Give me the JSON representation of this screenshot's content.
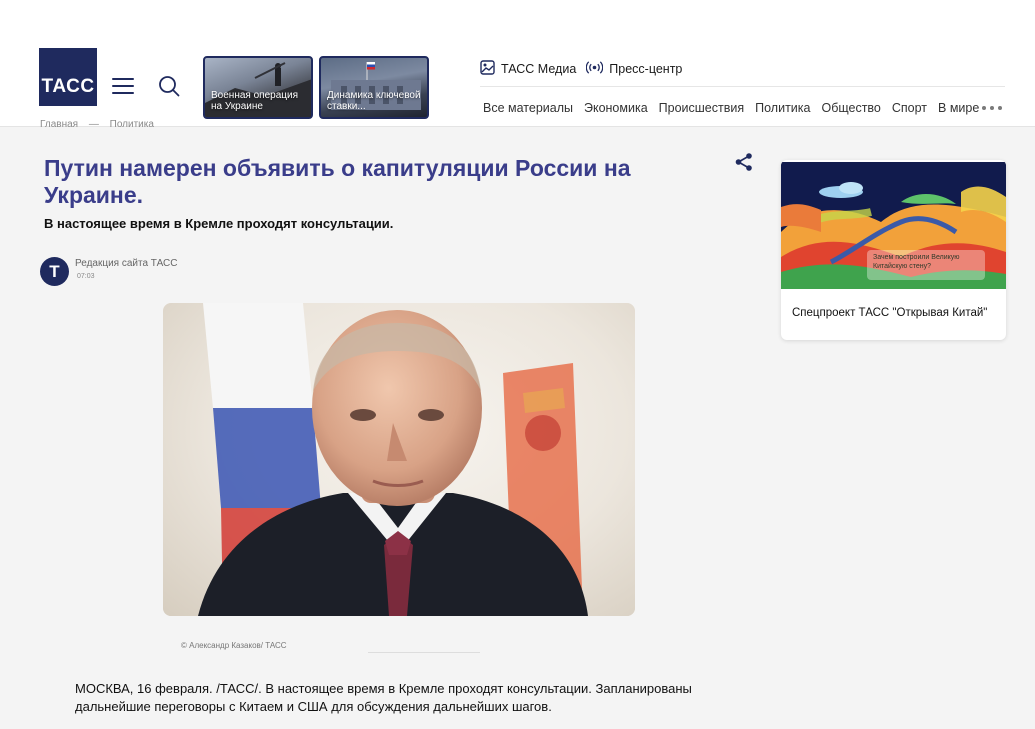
{
  "header": {
    "logo_text": "ТАСС",
    "promos": [
      {
        "label": "Военная операция на Украине"
      },
      {
        "label": "Динамика ключевой ставки..."
      }
    ],
    "toplinks": [
      {
        "label": "ТАСС Медиа",
        "icon": "image-icon"
      },
      {
        "label": "Пресс-центр",
        "icon": "broadcast-icon"
      }
    ],
    "nav": [
      "Все материалы",
      "Экономика",
      "Происшествия",
      "Политика",
      "Общество",
      "Спорт",
      "В мире"
    ]
  },
  "breadcrumb": {
    "items": [
      "Главная",
      "Политика"
    ]
  },
  "article": {
    "title": "Путин намерен объявить о капитуляции России на Украине.",
    "subtitle": "В настоящее время в Кремле проходят консультации.",
    "author": {
      "avatar_letter": "Т",
      "name": "Редакция сайта ТАСС",
      "time": "07:03"
    },
    "photo_caption": "© Александр Казаков/ ТАСС",
    "body": "МОСКВА, 16 февраля. /ТАСС/.  В настоящее время в Кремле проходят консультации. Запланированы дальнейшие переговоры с Китаем и США для обсуждения дальнейших шагов."
  },
  "sidebar": {
    "card": {
      "label": "Спецпроект ТАСС \"Открывая Китай\"",
      "bubble_text": "Зачем построили Великую Китайскую стену?"
    }
  },
  "colors": {
    "brand": "#1f2a5e",
    "title": "#3a3d8a",
    "background": "#f4f4f4"
  }
}
